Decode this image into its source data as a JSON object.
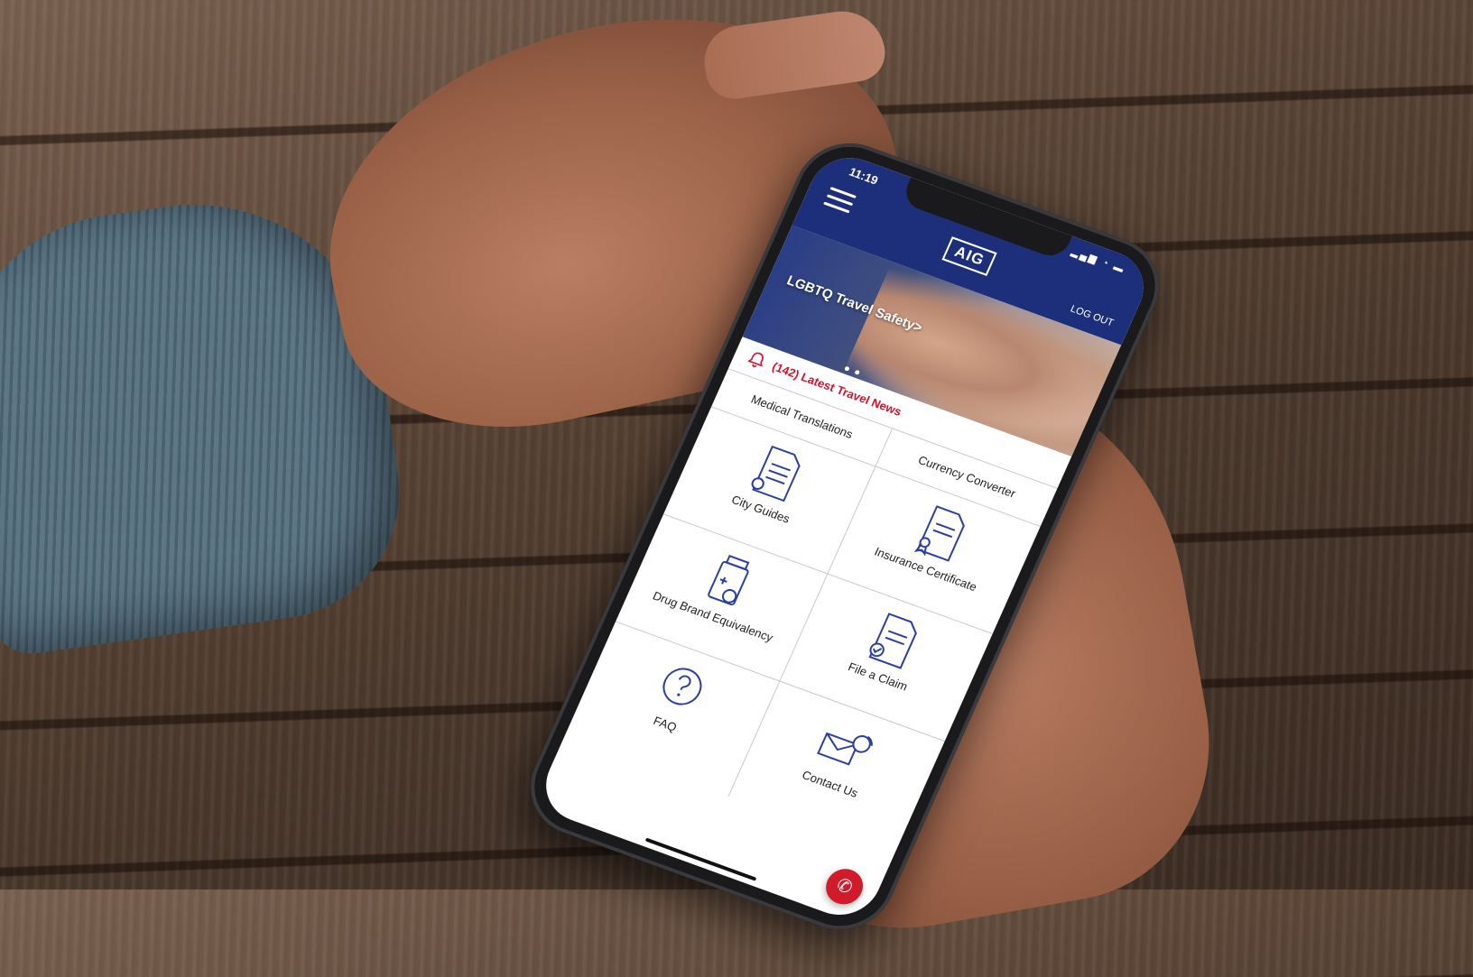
{
  "status": {
    "time": "11:19",
    "signal": "▂▄▆ ◔ ▬"
  },
  "header": {
    "logo": "AIG",
    "logout": "LOG OUT"
  },
  "banner": {
    "title": "LGBTQ Travel Safety>"
  },
  "news": {
    "label": "(142) Latest Travel News"
  },
  "tiles": {
    "medical": "Medical Translations",
    "currency": "Currency Converter",
    "city": "City Guides",
    "insurance": "Insurance Certificate",
    "drug": "Drug Brand Equivalency",
    "claim": "File a Claim",
    "faq": "FAQ",
    "contact": "Contact Us"
  },
  "colors": {
    "brand": "#1d2f7a",
    "accent": "#d6102a",
    "icon": "#2a3fa0"
  },
  "icons": [
    "menu-icon",
    "bell-icon",
    "document-icon",
    "certificate-icon",
    "pill-bottle-icon",
    "claim-icon",
    "question-icon",
    "envelope-phone-icon",
    "phone-icon"
  ]
}
